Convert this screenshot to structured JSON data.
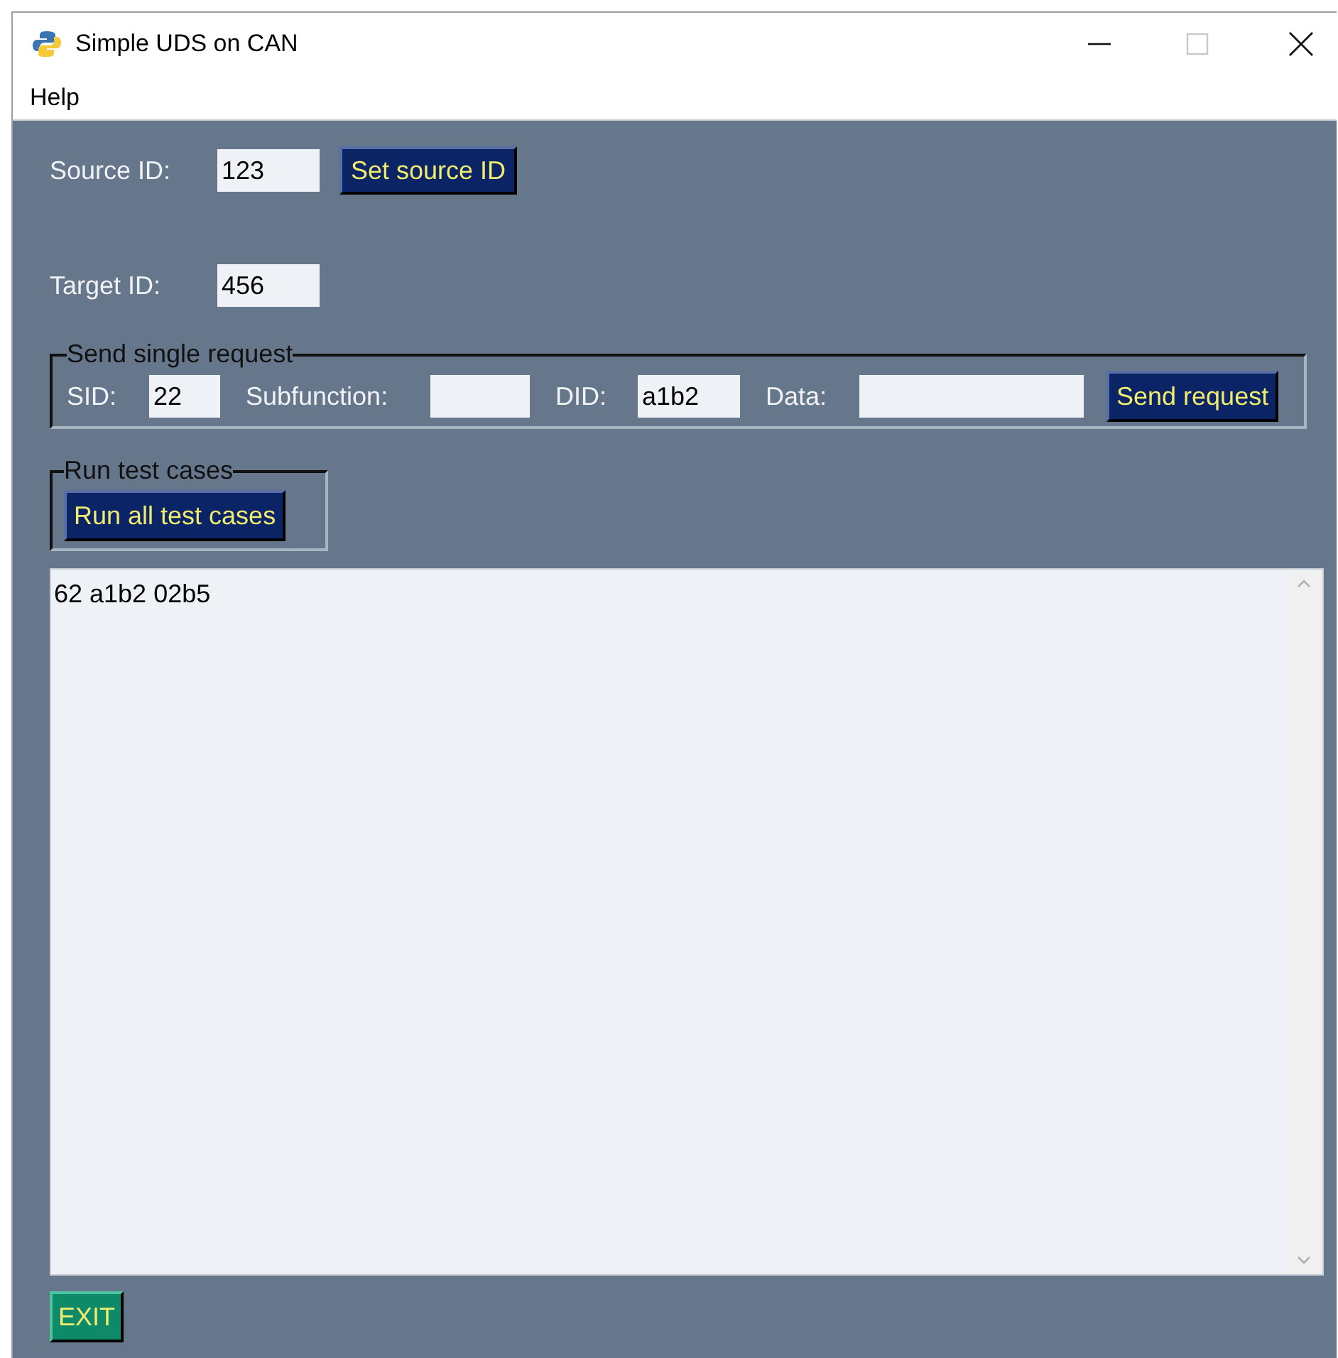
{
  "window": {
    "title": "Simple UDS on CAN"
  },
  "menu": [
    "Help"
  ],
  "source": {
    "label": "Source ID:",
    "value": "123",
    "button": "Set source ID"
  },
  "target": {
    "label": "Target ID:",
    "value": "456"
  },
  "single_request": {
    "title": "Send single request",
    "fields": [
      {
        "label": "SID:",
        "value": "22"
      },
      {
        "label": "Subfunction:"
      },
      {
        "label": "DID:",
        "value": "a1b2"
      },
      {
        "label": "Data:"
      }
    ],
    "button": "Send request"
  },
  "test_cases": {
    "title": "Run test cases",
    "button": "Run all test cases"
  },
  "output": {
    "text": "62 a1b2 02b5"
  },
  "exit_button": "EXIT"
}
